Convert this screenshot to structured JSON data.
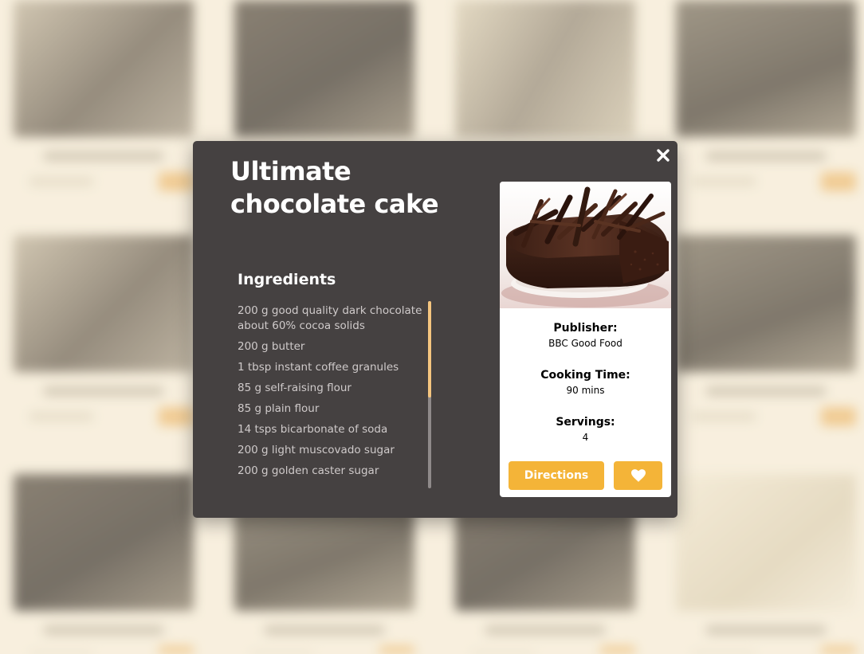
{
  "modal": {
    "title": "Ultimate chocolate cake",
    "ingredients_heading": "Ingredients",
    "ingredients": [
      "200 g good quality dark chocolate about 60% cocoa solids",
      "200 g butter",
      "1 tbsp instant coffee granules",
      "85 g self-raising flour",
      "85 g plain flour",
      "14 tsps bicarbonate of soda",
      "200 g light muscovado sugar",
      "200 g golden caster sugar"
    ],
    "ingredients_scroll_fraction": 0.0,
    "info": {
      "publisher_label": "Publisher:",
      "publisher": "BBC Good Food",
      "cooking_time_label": "Cooking Time:",
      "cooking_time": "90 mins",
      "servings_label": "Servings:",
      "servings": "4"
    },
    "buttons": {
      "directions": "Directions",
      "favorite_icon": "heart-icon",
      "close_icon": "close-icon"
    }
  },
  "colors": {
    "modal_bg": "#454141",
    "accent": "#f4b438",
    "scroll_thumb": "#f5c57f"
  }
}
